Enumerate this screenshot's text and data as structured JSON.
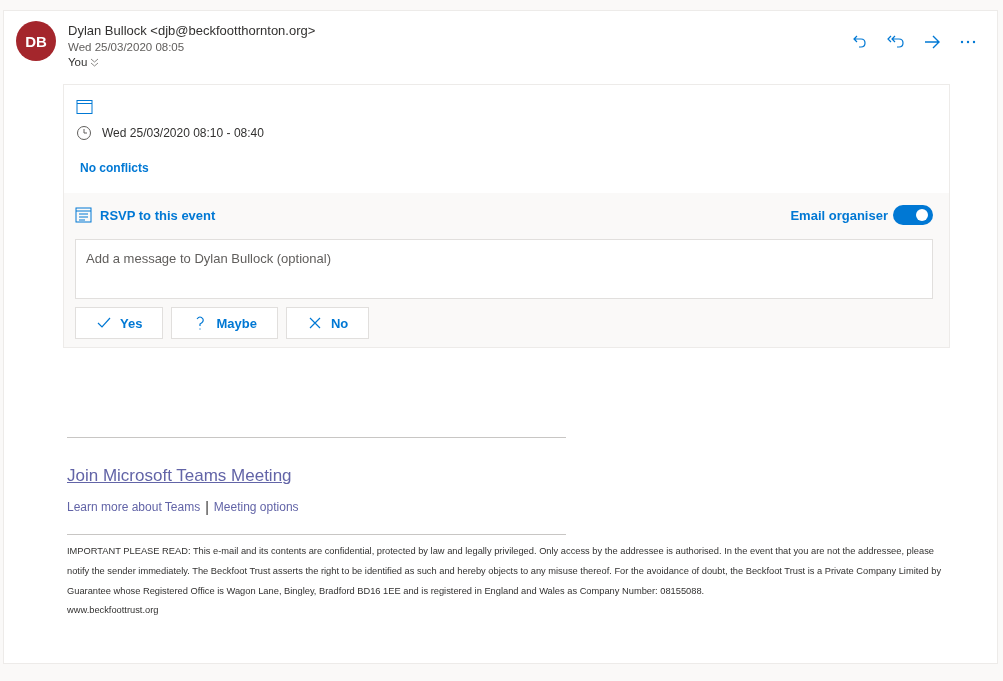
{
  "message": {
    "avatar_initials": "DB",
    "sender": "Dylan Bullock <djb@beckfootthornton.org>",
    "sent": "Wed 25/03/2020 08:05",
    "to": "You"
  },
  "event": {
    "time": "Wed 25/03/2020 08:10 - 08:40",
    "conflicts": "No conflicts"
  },
  "rsvp": {
    "title": "RSVP to this event",
    "email_organiser_label": "Email organiser",
    "email_organiser_on": true,
    "message_placeholder": "Add a message to Dylan Bullock (optional)",
    "buttons": [
      {
        "kind": "yes",
        "label": "Yes"
      },
      {
        "kind": "maybe",
        "label": "Maybe"
      },
      {
        "kind": "no",
        "label": "No"
      }
    ]
  },
  "teams": {
    "join_link": "Join Microsoft Teams Meeting",
    "learn_more": "Learn more about Teams",
    "separator": "|",
    "options": "Meeting options"
  },
  "disclaimer": "IMPORTANT PLEASE READ: This e-mail and its contents are confidential, protected by law and legally privileged. Only access by the addressee is authorised. In the event that you are not the addressee, please notify the sender immediately. The Beckfoot Trust asserts the right to be identified as such and hereby objects to any misuse thereof. For the avoidance of doubt, the Beckfoot Trust is a Private Company Limited by Guarantee whose Registered Office is Wagon Lane, Bingley, Bradford BD16 1EE and is registered in England and Wales as Company Number: 08155088.",
  "website": "www.beckfoottrust.org"
}
